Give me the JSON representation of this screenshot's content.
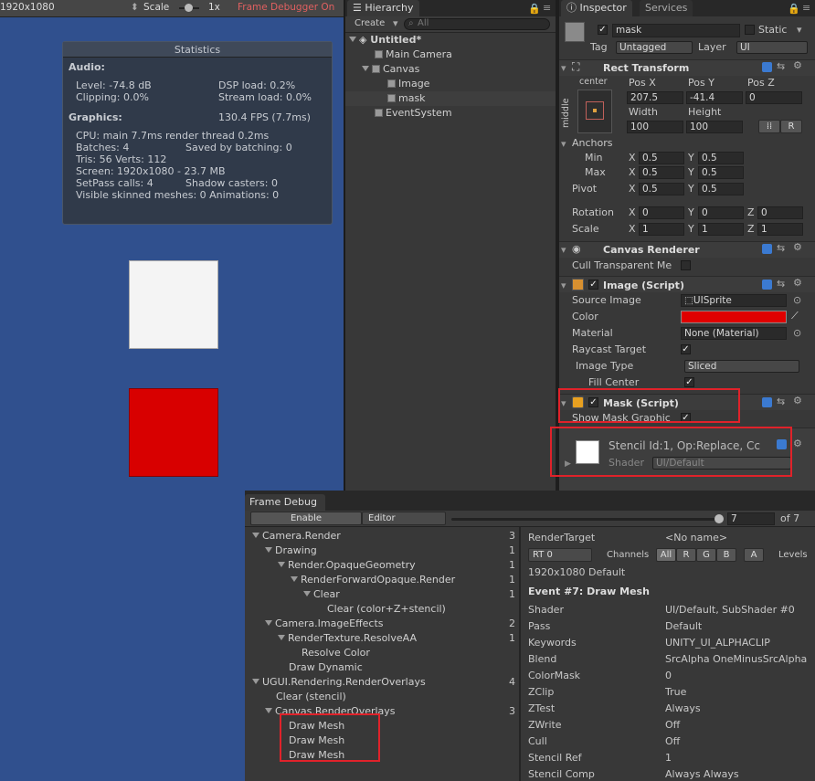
{
  "game": {
    "resolution": "1920x1080",
    "scale_label": "Scale",
    "scale_value": "1x",
    "frame_debugger": "Frame Debugger On"
  },
  "stats": {
    "title": "Statistics",
    "audio_h": "Audio:",
    "level": "Level: -74.8 dB",
    "clipping": "Clipping: 0.0%",
    "dsp": "DSP load: 0.2%",
    "stream": "Stream load: 0.0%",
    "graphics_h": "Graphics:",
    "fps": "130.4 FPS (7.7ms)",
    "cpu": "CPU: main 7.7ms  render thread 0.2ms",
    "batches": "Batches: 4",
    "saved": "Saved by batching: 0",
    "tris": "Tris: 56    Verts: 112",
    "screen": "Screen: 1920x1080 - 23.7 MB",
    "setpass": "SetPass calls: 4",
    "shadow": "Shadow casters: 0",
    "skinned": "Visible skinned meshes: 0  Animations: 0"
  },
  "hierarchy": {
    "tab": "Hierarchy",
    "create": "Create",
    "search_placeholder": "All",
    "scene": "Untitled*",
    "items": [
      "Main Camera",
      "Canvas",
      "Image",
      "mask",
      "EventSystem"
    ]
  },
  "inspector": {
    "tab": "Inspector",
    "tab2": "Services",
    "name": "mask",
    "static": "Static",
    "tag_label": "Tag",
    "tag": "Untagged",
    "layer_label": "Layer",
    "layer": "UI",
    "rect_title": "Rect Transform",
    "center": "center",
    "middle": "middle",
    "posx_l": "Pos X",
    "posy_l": "Pos Y",
    "posz_l": "Pos Z",
    "posx": "207.5",
    "posy": "-41.4",
    "posz": "0",
    "width_l": "Width",
    "height_l": "Height",
    "width": "100",
    "height": "100",
    "r_btn": "R",
    "anchors": "Anchors",
    "min": "Min",
    "max": "Max",
    "pivot": "Pivot",
    "x": "X",
    "y": "Y",
    "z": "Z",
    "min_x": "0.5",
    "min_y": "0.5",
    "max_x": "0.5",
    "max_y": "0.5",
    "piv_x": "0.5",
    "piv_y": "0.5",
    "rotation": "Rotation",
    "scale": "Scale",
    "rot_x": "0",
    "rot_y": "0",
    "rot_z": "0",
    "sc_x": "1",
    "sc_y": "1",
    "sc_z": "1",
    "cr_title": "Canvas Renderer",
    "cull": "Cull Transparent Me",
    "img_title": "Image (Script)",
    "source_l": "Source Image",
    "source": "UISprite",
    "color_l": "Color",
    "material_l": "Material",
    "material": "None (Material)",
    "raycast": "Raycast Target",
    "imgtype_l": "Image Type",
    "imgtype": "Sliced",
    "fill": "Fill Center",
    "mask_title": "Mask (Script)",
    "show_mask": "Show Mask Graphic",
    "stencil": "Stencil Id:1, Op:Replace, Cc",
    "shader_l": "Shader",
    "shader": "UI/Default",
    "color_red": "#e00000"
  },
  "frame": {
    "tab": "Frame Debug",
    "enable": "Enable",
    "editor": "Editor",
    "event": "7",
    "of": "of 7",
    "tree": [
      {
        "label": "Camera.Render",
        "count": "3"
      },
      {
        "label": "Drawing",
        "count": "1"
      },
      {
        "label": "Render.OpaqueGeometry",
        "count": "1"
      },
      {
        "label": "RenderForwardOpaque.Render",
        "count": "1"
      },
      {
        "label": "Clear",
        "count": "1"
      },
      {
        "label": "Clear (color+Z+stencil)",
        "count": ""
      },
      {
        "label": "Camera.ImageEffects",
        "count": "2"
      },
      {
        "label": "RenderTexture.ResolveAA",
        "count": "1"
      },
      {
        "label": "Resolve Color",
        "count": ""
      },
      {
        "label": "Draw Dynamic",
        "count": ""
      },
      {
        "label": "UGUI.Rendering.RenderOverlays",
        "count": "4"
      },
      {
        "label": "Clear (stencil)",
        "count": ""
      },
      {
        "label": "Canvas.RenderOverlays",
        "count": "3"
      },
      {
        "label": "Draw Mesh",
        "count": ""
      },
      {
        "label": "Draw Mesh",
        "count": ""
      },
      {
        "label": "Draw Mesh",
        "count": ""
      }
    ],
    "rt_l": "RenderTarget",
    "rt": "<No name>",
    "rt0": "RT 0",
    "channels": "Channels",
    "ch": [
      "All",
      "R",
      "G",
      "B",
      "A"
    ],
    "levels": "Levels",
    "res": "1920x1080 Default",
    "event_title": "Event #7: Draw Mesh",
    "props": [
      {
        "k": "Shader",
        "v": "UI/Default, SubShader #0"
      },
      {
        "k": "Pass",
        "v": "Default"
      },
      {
        "k": "Keywords",
        "v": "UNITY_UI_ALPHACLIP"
      },
      {
        "k": "Blend",
        "v": "SrcAlpha OneMinusSrcAlpha"
      },
      {
        "k": "ColorMask",
        "v": "0"
      },
      {
        "k": "ZClip",
        "v": "True"
      },
      {
        "k": "ZTest",
        "v": "Always"
      },
      {
        "k": "ZWrite",
        "v": "Off"
      },
      {
        "k": "Cull",
        "v": "Off"
      },
      {
        "k": "Stencil Ref",
        "v": "1"
      },
      {
        "k": "Stencil Comp",
        "v": "Always Always"
      }
    ]
  }
}
